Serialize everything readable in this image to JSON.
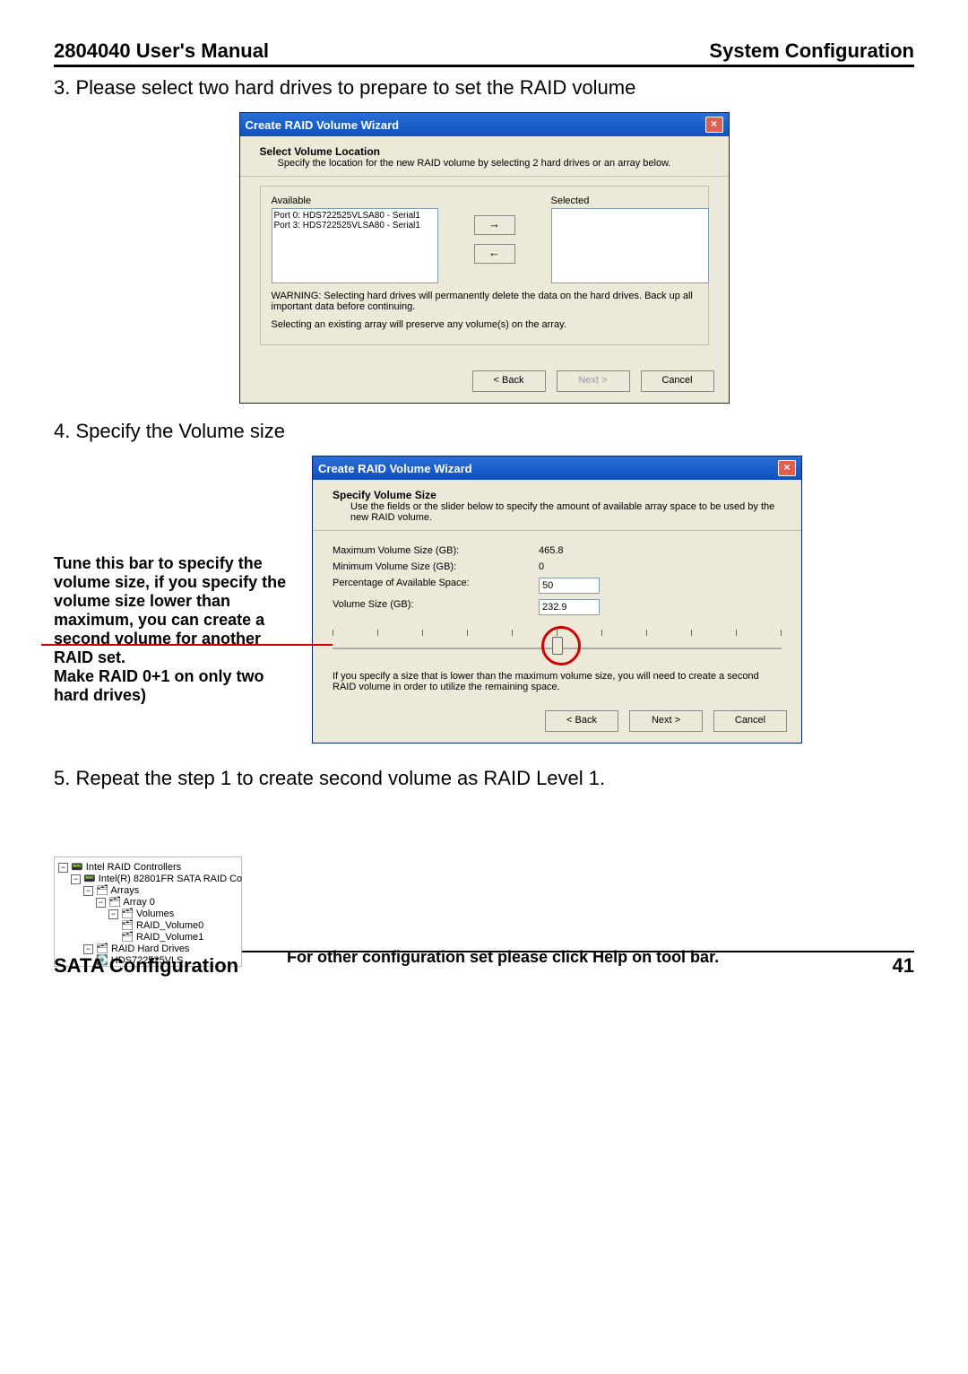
{
  "header": {
    "left": "2804040 User's Manual",
    "right": "System Configuration"
  },
  "step3": "3. Please select two hard drives to prepare to set the RAID volume",
  "dialog1": {
    "title": "Create RAID Volume Wizard",
    "head_title": "Select Volume Location",
    "head_desc": "Specify the location for the new RAID volume by selecting 2 hard drives or an array below.",
    "available_label": "Available",
    "selected_label": "Selected",
    "drive0": "Port 0: HDS722525VLSA80 - Serial1",
    "drive1": "Port 3: HDS722525VLSA80 - Serial1",
    "arrow_r": "→",
    "arrow_l": "←",
    "warn1": "WARNING: Selecting hard drives will permanently delete the data on the hard drives. Back up all important data before continuing.",
    "warn2": "Selecting an existing array will preserve any volume(s) on the array.",
    "back": "< Back",
    "next": "Next >",
    "cancel": "Cancel"
  },
  "step4": "4. Specify the Volume size",
  "side_note": "Tune this bar to specify the volume size, if you specify the volume size lower than maximum, you can create a second volume for another RAID set.\nMake RAID 0+1 on only two hard drives)",
  "dialog2": {
    "title": "Create RAID Volume Wizard",
    "head_title": "Specify Volume Size",
    "head_desc": "Use the fields or the slider below to specify the amount of available array space to be used by the new RAID volume.",
    "max_l": "Maximum Volume Size (GB):",
    "max_v": "465.8",
    "min_l": "Minimum Volume Size (GB):",
    "min_v": "0",
    "pct_l": "Percentage of Available Space:",
    "pct_v": "50",
    "vol_l": "Volume Size (GB):",
    "vol_v": "232.9",
    "note": "If you specify a size that is lower than the maximum volume size, you will need to create a second RAID volume in order to utilize the remaining space.",
    "back": "< Back",
    "next": "Next >",
    "cancel": "Cancel"
  },
  "step5": "5. Repeat the step 1 to create second volume as RAID Level 1.",
  "tree": {
    "t0": "Intel RAID Controllers",
    "t1": "Intel(R) 82801FR SATA RAID Co",
    "t2": "Arrays",
    "t3": "Array 0",
    "t4": "Volumes",
    "t5": "RAID_Volume0",
    "t6": "RAID_Volume1",
    "t7": "RAID Hard Drives",
    "t8": "HDS722525VLS"
  },
  "footer_note": "For other configuration set please click Help on tool bar.",
  "footer": {
    "left": "SATA Configuration",
    "right": "41"
  }
}
